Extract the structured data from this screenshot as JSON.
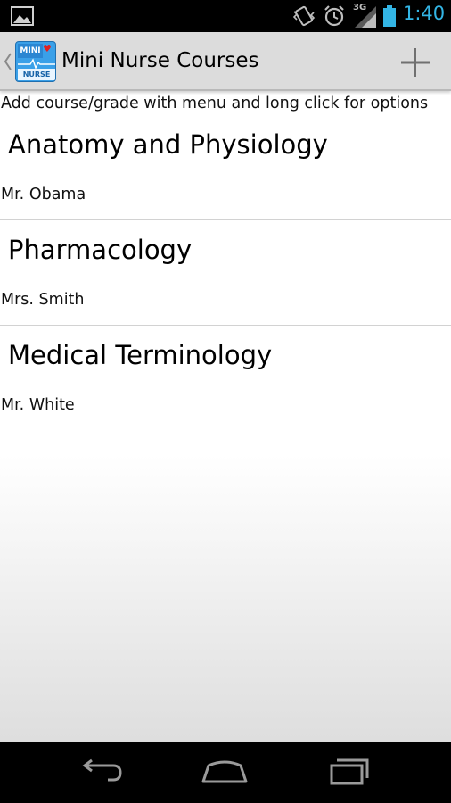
{
  "status_bar": {
    "network": "3G",
    "time": "1:40",
    "icons": [
      "gallery-icon",
      "vibrate-icon",
      "alarm-icon",
      "signal-icon",
      "battery-icon"
    ],
    "clock_color": "#33b5e5"
  },
  "action_bar": {
    "title": "Mini Nurse Courses",
    "logo_top": "MINI",
    "logo_bottom": "NURSE",
    "add_icon": "plus-icon"
  },
  "hint": "Add course/grade with menu and long click for options",
  "courses": [
    {
      "name": "Anatomy and Physiology",
      "teacher": "Mr. Obama"
    },
    {
      "name": "Pharmacology",
      "teacher": "Mrs. Smith"
    },
    {
      "name": "Medical Terminology",
      "teacher": "Mr. White"
    }
  ],
  "nav_bar": {
    "icons": [
      "back-icon",
      "home-icon",
      "recent-apps-icon"
    ]
  }
}
